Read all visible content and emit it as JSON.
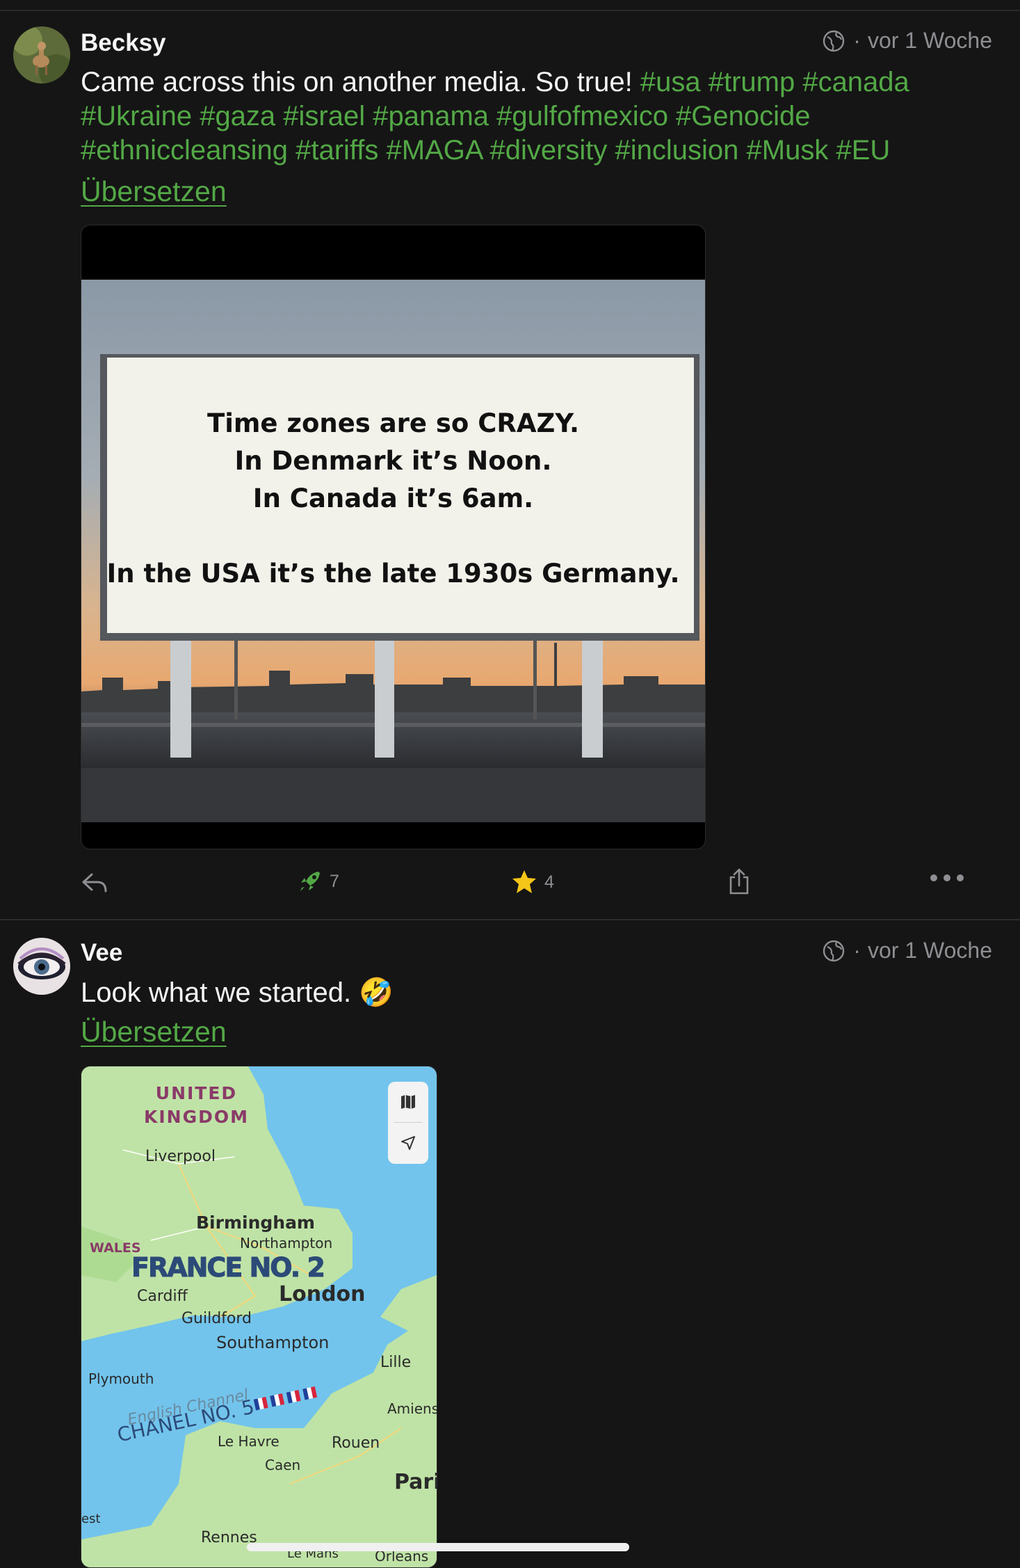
{
  "posts": [
    {
      "author": "Becksy",
      "time": "vor 1 Woche",
      "text_plain": "Came across this on another media. So true!",
      "hashtags_line1": "#usa #trump #canada",
      "hashtags_line2": "#Ukraine #gaza #israel #panama #gulfofmexico #Genocide",
      "hashtags_line3": "#ethniccleansing #tariffs #MAGA #diversity #inclusion #Musk #EU",
      "translate": "Übersetzen",
      "image": {
        "line1": "Time zones are so CRAZY.",
        "line2": "In Denmark it’s Noon.",
        "line3": "In Canada it’s 6am.",
        "line4": "In the USA it’s the late 1930s Germany."
      },
      "actions": {
        "boost_count": "7",
        "favourite_count": "4"
      }
    },
    {
      "author": "Vee",
      "time": "vor 1 Woche",
      "text": "Look what we started. 🤣",
      "translate": "Übersetzen",
      "map": {
        "uk_line1": "UNITED",
        "uk_line2": "KINGDOM",
        "wales": "WALES",
        "liverpool": "Liverpool",
        "birmingham": "Birmingham",
        "northampton": "Northampton",
        "france_no2": "FRANCE NO. 2",
        "cardiff": "Cardiff",
        "london": "London",
        "guildford": "Guildford",
        "southampton": "Southampton",
        "plymouth": "Plymouth",
        "english_channel": "English Channel",
        "chanel_no5": "CHANEL NO. 5",
        "lille": "Lille",
        "amiens": "Amiens",
        "le_havre": "Le Havre",
        "rouen": "Rouen",
        "caen": "Caen",
        "paris": "Pari",
        "brest": "est",
        "rennes": "Rennes",
        "le_mans": "Le Mans",
        "orleans": "Orleans"
      }
    }
  ],
  "colors": {
    "background": "#151515",
    "accent_green": "#53a846",
    "star": "#f5c518",
    "meta_gray": "#8e8e93"
  }
}
